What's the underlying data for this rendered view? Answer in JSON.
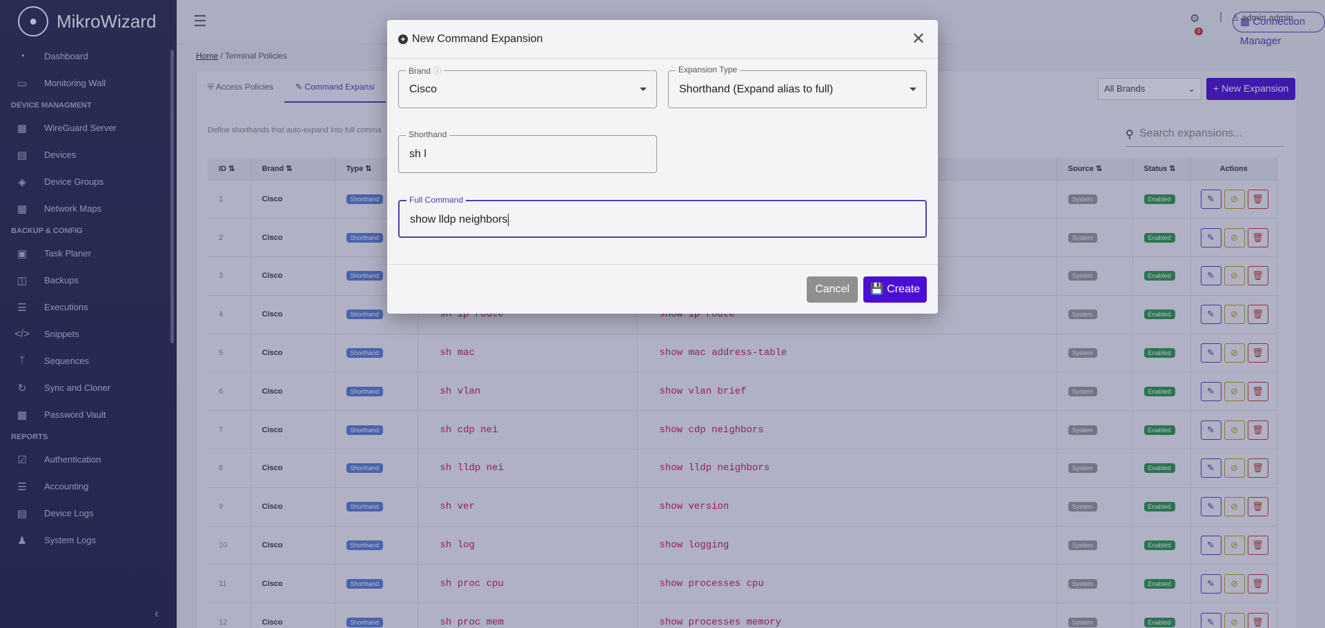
{
  "app": {
    "name": "MikroWizard"
  },
  "sidebar": {
    "items_top": [
      {
        "label": "Dashboard",
        "icon": "dashboard-icon"
      },
      {
        "label": "Monitoring Wall",
        "icon": "monitor-icon"
      }
    ],
    "sections": [
      {
        "title": "DEVICE MANAGMENT",
        "items": [
          {
            "label": "WireGuard Server",
            "icon": "network-icon"
          },
          {
            "label": "Devices",
            "icon": "server-icon"
          },
          {
            "label": "Device Groups",
            "icon": "layers-icon"
          },
          {
            "label": "Network Maps",
            "icon": "map-icon"
          }
        ]
      },
      {
        "title": "BACKUP & CONFIG",
        "items": [
          {
            "label": "Task Planer",
            "icon": "calendar-icon"
          },
          {
            "label": "Backups",
            "icon": "database-icon"
          },
          {
            "label": "Executions",
            "icon": "list-icon"
          },
          {
            "label": "Snippets",
            "icon": "code-icon"
          },
          {
            "label": "Sequences",
            "icon": "branch-icon"
          },
          {
            "label": "Sync and Cloner",
            "icon": "sync-icon"
          },
          {
            "label": "Password Vault",
            "icon": "vault-icon"
          }
        ]
      },
      {
        "title": "REPORTS",
        "items": [
          {
            "label": "Authentication",
            "icon": "check-square-icon"
          },
          {
            "label": "Accounting",
            "icon": "list-check-icon"
          },
          {
            "label": "Device Logs",
            "icon": "log-icon"
          },
          {
            "label": "System Logs",
            "icon": "user-log-icon"
          }
        ]
      }
    ]
  },
  "topbar": {
    "connection_manager": "Connection Manager",
    "notif_count": "0",
    "user": "admin admin"
  },
  "breadcrumb": {
    "home": "Home",
    "sep": "/",
    "current": "Terminal Policies"
  },
  "tabs": [
    {
      "label": "Access Policies"
    },
    {
      "label": "Command Expansi"
    }
  ],
  "filter": {
    "brand_select": "All Brands",
    "new_button": "+ New Expansion"
  },
  "description": "Define shorthands that auto-expand into full comma",
  "search": {
    "placeholder": "Search expansions..."
  },
  "table": {
    "headers": {
      "id": "ID",
      "brand": "Brand",
      "type": "Type",
      "source": "Source",
      "status": "Status",
      "actions": "Actions"
    },
    "rows": [
      {
        "id": "1",
        "brand": "Cisco",
        "type": "Shorthand",
        "short": "",
        "full": "",
        "source": "System",
        "status": "Enabled"
      },
      {
        "id": "2",
        "brand": "Cisco",
        "type": "Shorthand",
        "short": "",
        "full": "",
        "source": "System",
        "status": "Enabled"
      },
      {
        "id": "3",
        "brand": "Cisco",
        "type": "Shorthand",
        "short": "",
        "full": "",
        "source": "System",
        "status": "Enabled"
      },
      {
        "id": "4",
        "brand": "Cisco",
        "type": "Shorthand",
        "short": "sh ip route",
        "full": "show ip route",
        "source": "System",
        "status": "Enabled"
      },
      {
        "id": "5",
        "brand": "Cisco",
        "type": "Shorthand",
        "short": "sh mac",
        "full": "show mac address-table",
        "source": "System",
        "status": "Enabled"
      },
      {
        "id": "6",
        "brand": "Cisco",
        "type": "Shorthand",
        "short": "sh vlan",
        "full": "show vlan brief",
        "source": "System",
        "status": "Enabled"
      },
      {
        "id": "7",
        "brand": "Cisco",
        "type": "Shorthand",
        "short": "sh cdp nei",
        "full": "show cdp neighbors",
        "source": "System",
        "status": "Enabled"
      },
      {
        "id": "8",
        "brand": "Cisco",
        "type": "Shorthand",
        "short": "sh lldp nei",
        "full": "show lldp neighbors",
        "source": "System",
        "status": "Enabled"
      },
      {
        "id": "9",
        "brand": "Cisco",
        "type": "Shorthand",
        "short": "sh ver",
        "full": "show version",
        "source": "System",
        "status": "Enabled"
      },
      {
        "id": "10",
        "brand": "Cisco",
        "type": "Shorthand",
        "short": "sh log",
        "full": "show logging",
        "source": "System",
        "status": "Enabled"
      },
      {
        "id": "11",
        "brand": "Cisco",
        "type": "Shorthand",
        "short": "sh proc cpu",
        "full": "show processes cpu",
        "source": "System",
        "status": "Enabled"
      },
      {
        "id": "12",
        "brand": "Cisco",
        "type": "Shorthand",
        "short": "sh proc mem",
        "full": "show processes memory",
        "source": "System",
        "status": "Enabled"
      }
    ]
  },
  "modal": {
    "title": "New Command Expansion",
    "brand_label": "Brand",
    "brand_value": "Cisco",
    "type_label": "Expansion Type",
    "type_value": "Shorthand (Expand alias to full)",
    "short_label": "Shorthand",
    "short_value": "sh l",
    "full_label": "Full Command",
    "full_value": "show lldp neighbors",
    "cancel": "Cancel",
    "create": "Create"
  }
}
